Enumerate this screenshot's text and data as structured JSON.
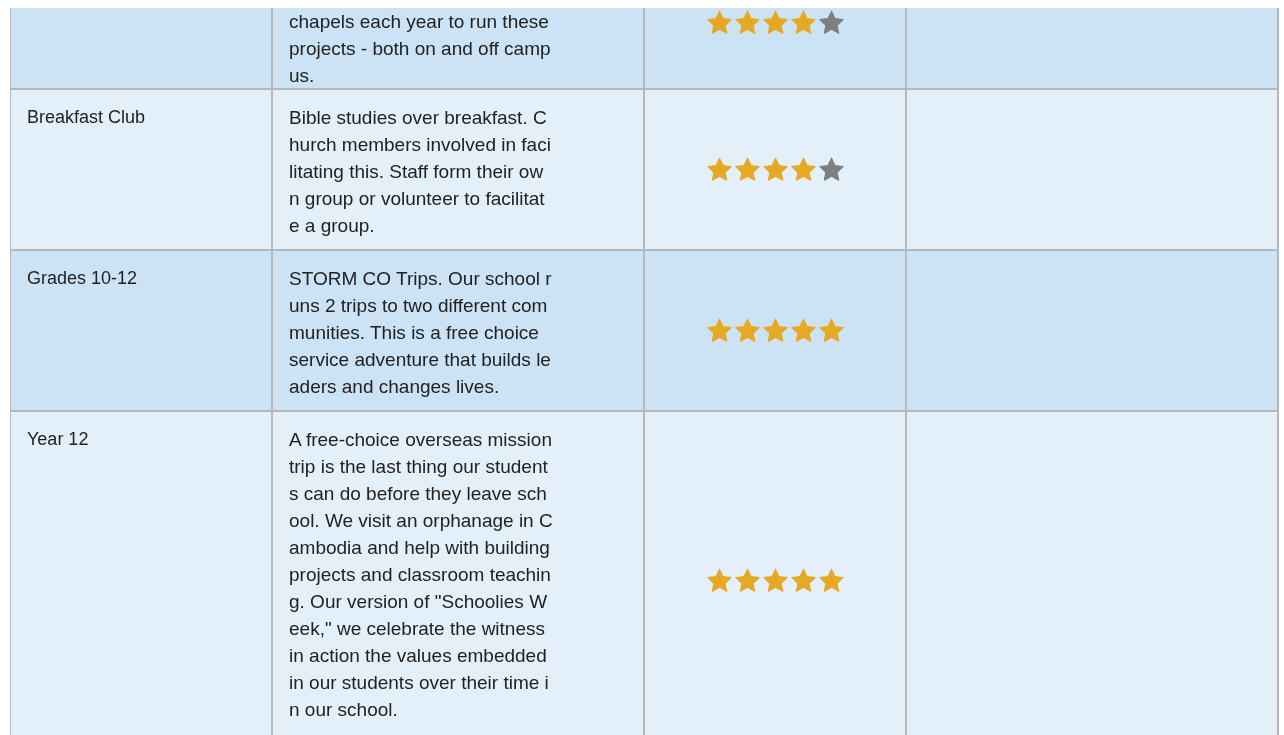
{
  "table": {
    "rows": [
      {
        "group": "",
        "description": "chapels each year to run these projects - both on and off campus.",
        "stars": 4
      },
      {
        "group": "Breakfast Club",
        "description": "Bible studies over breakfast. Church members involved in facilitating this. Staff form their own group or volunteer to facilitate a group.",
        "stars": 4
      },
      {
        "group": "Grades 10-12",
        "description": "STORM CO Trips. Our school runs 2 trips to two different communities. This is a free choice service adventure that builds leaders and changes lives.",
        "stars": 5
      },
      {
        "group": "Year 12",
        "description": "A free-choice overseas mission trip is the last thing our students can do before they leave school. We visit an orphanage in Cambodia and help with building projects and classroom teaching. Our version of \"Schoolies Week,\" we celebrate the witness in action the values embedded in our students over their time in our school.",
        "stars": 5
      }
    ]
  }
}
